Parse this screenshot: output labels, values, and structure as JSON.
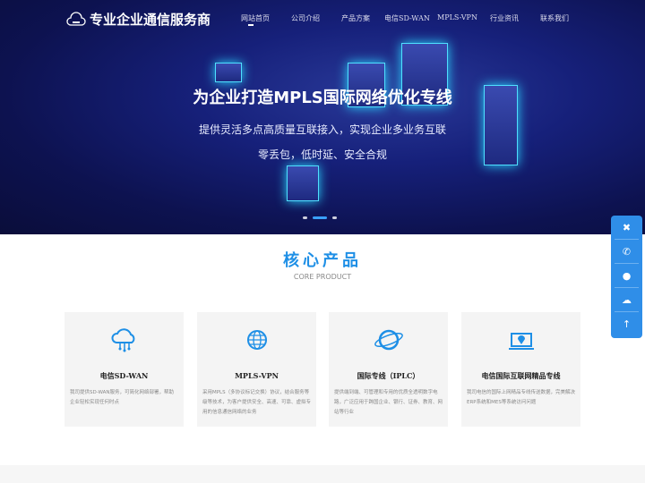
{
  "header": {
    "logo_text": "专业企业通信服务商",
    "nav": [
      "网站首页",
      "公司介绍",
      "产品方案",
      "电信SD-WAN",
      "MPLS-VPN",
      "行业资讯",
      "联系我们"
    ],
    "active_index": 0
  },
  "banner": {
    "title": "为企业打造MPLS国际网络优化专线",
    "line1": "提供灵活多点高质量互联接入，实现企业多业务互联",
    "line2": "零丢包，低时延、安全合规",
    "slides": 3,
    "active_slide": 1
  },
  "products": {
    "title": "核心产品",
    "subtitle": "CORE PRODUCT",
    "items": [
      {
        "title": "电信SD-WAN",
        "desc": "我司提供SD-WAN服务，可简化网络部署，帮助企业轻松实现任何时点",
        "icon": "cloud-network-icon"
      },
      {
        "title": "MPLS-VPN",
        "desc": "采用MPLS（多协议标记交换）协议，结合服务等级等技术，为客户提供安全、高速、可靠、虚拟专用的信息通信网络的业务",
        "icon": "globe-icon"
      },
      {
        "title": "国际专线（IPLC）",
        "desc": "提供端到端、可管理和专用的优质全透明数字电路，广泛应用于跨国企业、银行、证券、教育、网站等行业",
        "icon": "planet-icon"
      },
      {
        "title": "电信国际互联网精品专线",
        "desc": "我司电信的国际上网精品专线传送数据，完美解决ERP系统和MES等系统访问问题",
        "icon": "laptop-location-icon"
      }
    ]
  },
  "sidebar": {
    "icons": [
      "close-icon",
      "phone-icon",
      "qq-icon",
      "wechat-icon",
      "back-to-top-icon"
    ]
  },
  "colors": {
    "accent": "#1e8fe6",
    "hero_bg": "#0d1250",
    "side_bar": "#2f8ee8"
  }
}
